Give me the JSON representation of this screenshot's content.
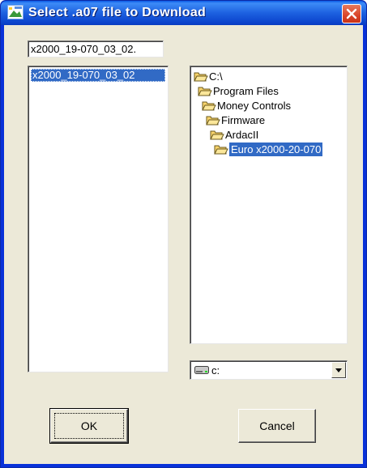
{
  "window": {
    "title": "Select .a07 file to Download",
    "app_icon": "dialog-icon",
    "close_icon": "close-icon"
  },
  "file_panel": {
    "filename_value": "x2000_19-070_03_02.",
    "files": [
      "x2000_19-070_03_02"
    ]
  },
  "directory_panel": {
    "folders": [
      {
        "label": "C:\\",
        "level": 0,
        "selected": false
      },
      {
        "label": "Program Files",
        "level": 1,
        "selected": false
      },
      {
        "label": "Money Controls",
        "level": 2,
        "selected": false
      },
      {
        "label": "Firmware",
        "level": 3,
        "selected": false
      },
      {
        "label": "ArdacII",
        "level": 4,
        "selected": false
      },
      {
        "label": "Euro x2000-20-070",
        "level": 5,
        "selected": true
      }
    ]
  },
  "drive": {
    "value": "c:",
    "icon": "drive-icon"
  },
  "buttons": {
    "ok_label": "OK",
    "cancel_label": "Cancel"
  },
  "colors": {
    "title_bar": "#0a45d0",
    "selection": "#316ac5",
    "dialog_bg": "#ece9d8",
    "close_button": "#d9452a"
  }
}
